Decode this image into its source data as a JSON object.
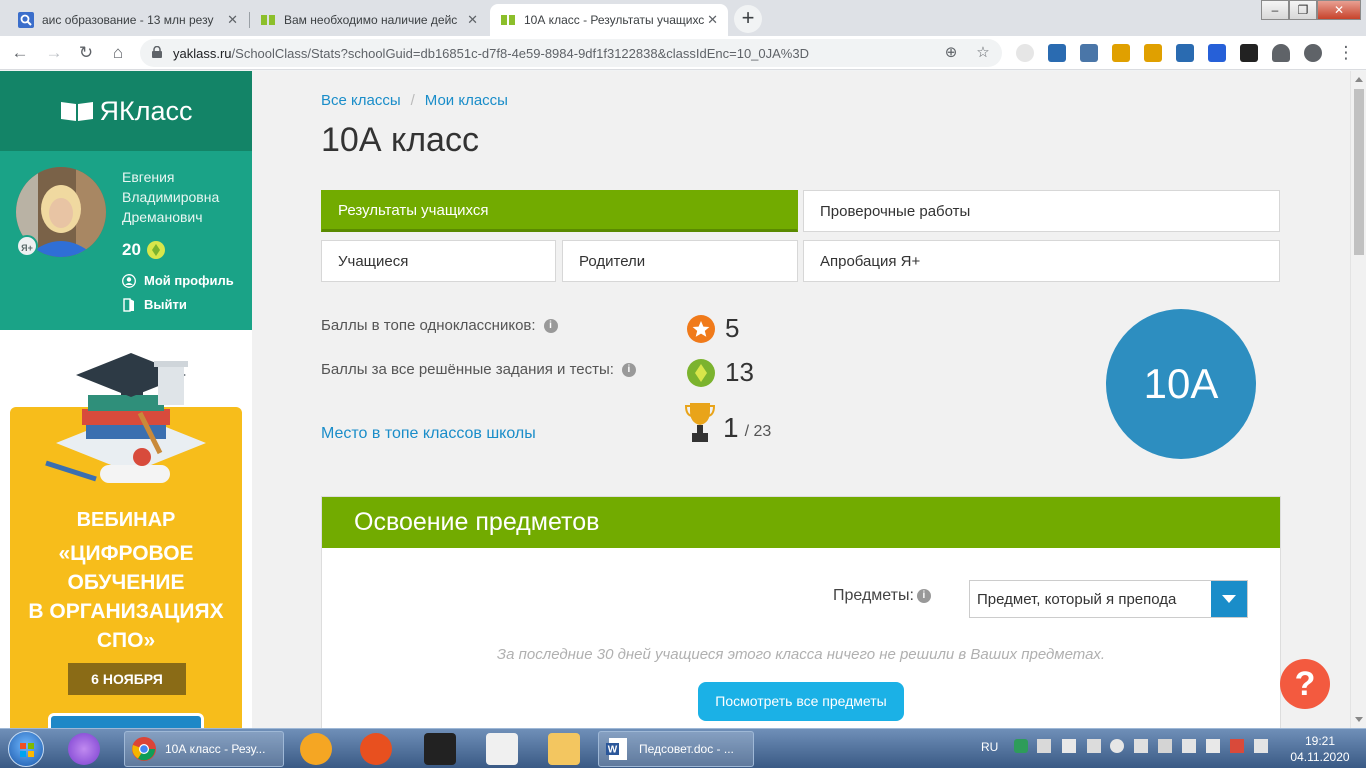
{
  "browser": {
    "tabs": [
      {
        "title": "аис образование - 13 млн резу",
        "icon": "search-favicon"
      },
      {
        "title": "Вам необходимо наличие дейс",
        "icon": "yaklass-favicon"
      },
      {
        "title": "10А класс - Результаты учащихся",
        "icon": "yaklass-favicon",
        "active": true
      }
    ],
    "address_host": "yaklass.ru",
    "address_path": "/SchoolClass/Stats?schoolGuid=db16851c-d7f8-4e59-8984-9df1f3122838&classIdEnc=10_0JA%3D"
  },
  "sidebar": {
    "logo_text": "ЯКласс",
    "user_name": "Евгения Владимировна Дреманович",
    "ya_badge": "Я+",
    "points": "20",
    "profile_link": "Мой профиль",
    "logout_link": "Выйти",
    "banner": {
      "webinar": "ВЕБИНАР",
      "title_lines": [
        "«ЦИФРОВОЕ",
        "ОБУЧЕНИЕ",
        "В ОРГАНИЗАЦИЯХ",
        "СПО»"
      ],
      "date": "6 НОЯБРЯ"
    }
  },
  "main": {
    "breadcrumbs": [
      "Все классы",
      "Мои классы"
    ],
    "title": "10А класс",
    "tabs": {
      "results": "Результаты учащихся",
      "tests": "Проверочные работы",
      "students": "Учащиеся",
      "parents": "Родители",
      "approbation": "Апробация Я+"
    },
    "stats": {
      "top_label": "Баллы в топе одноклассников:",
      "top_value": "5",
      "all_label": "Баллы за все решённые задания и тесты:",
      "all_value": "13",
      "place_label": "Место в топе классов школы",
      "place_value": "1",
      "place_total": "/ 23"
    },
    "class_badge": "10А",
    "panel": {
      "title": "Освоение предметов",
      "subjects_label": "Предметы:",
      "subjects_value": "Предмет, который я препода",
      "empty_note": "За последние 30 дней учащиеся этого класса ничего не решили в Ваших предметах.",
      "button": "Посмотреть все предметы"
    },
    "help": "?"
  },
  "taskbar": {
    "tasks": [
      {
        "title": "10А класс - Резу...",
        "icon": "chrome-icon"
      },
      {
        "title": "Педсовет.doc - ...",
        "icon": "word-icon"
      }
    ],
    "lang": "RU",
    "time": "19:21",
    "date": "04.11.2020"
  },
  "colors": {
    "brand_green": "#138467",
    "profile_green": "#1aa387",
    "accent_green": "#72ab00",
    "link_blue": "#1a8dc9",
    "class_circle": "#2d8ec0",
    "help_red": "#f35a3f",
    "banner_yellow": "#f7bd1b"
  }
}
